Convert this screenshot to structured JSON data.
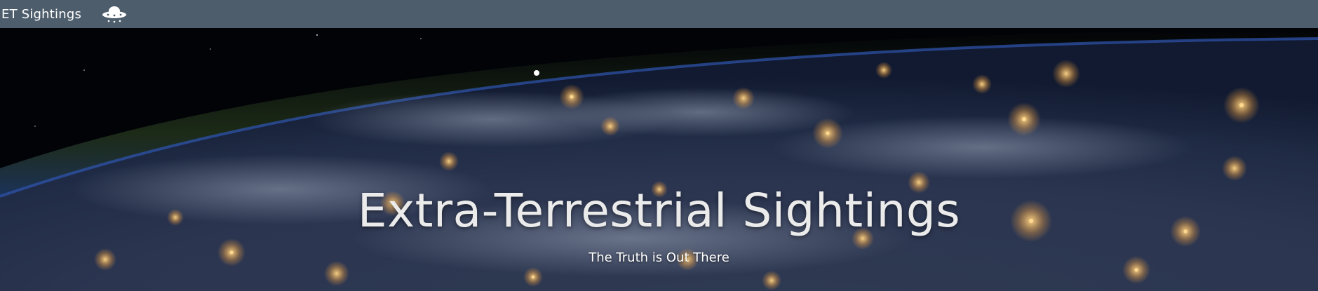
{
  "navbar": {
    "brand": "ET Sightings",
    "logo_icon": "ufo-icon",
    "background_color": "#4e5d6c"
  },
  "hero": {
    "background_image": "earth-at-night-from-space",
    "title": "Extra-Terrestrial Sightings",
    "subtitle": "The Truth is Out There"
  }
}
